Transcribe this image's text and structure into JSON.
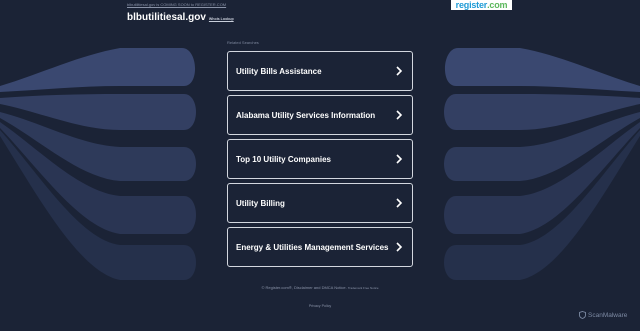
{
  "header": {
    "notice": "blbutilitiesal.gov is COMING SOON to REGISTER.COM",
    "domain": "blbutilitiesal.gov",
    "whois_link": "Whois Lookup",
    "logo_register": "register",
    "logo_dotcom": ".com"
  },
  "related": {
    "heading": "Related Searches",
    "items": [
      {
        "label": "Utility Bills Assistance"
      },
      {
        "label": "Alabama Utility Services Information"
      },
      {
        "label": "Top 10 Utility Companies"
      },
      {
        "label": "Utility Billing"
      },
      {
        "label": "Energy & Utilities Management Services"
      }
    ]
  },
  "footer": {
    "copyright": "© Register.com®, Disclaimer and DMCA Notice.",
    "trademark": "Trademark Free Notice",
    "privacy": "Privacy Policy",
    "badge": "ScanMalware"
  },
  "colors": {
    "background": "#1b2336",
    "band": "#303d5c",
    "item_border": "#d3d7df",
    "logo_blue": "#1e9bd6",
    "logo_green": "#5cb85c"
  },
  "icons": {
    "item_arrow": "chevron-right-icon",
    "badge": "shield-icon"
  }
}
